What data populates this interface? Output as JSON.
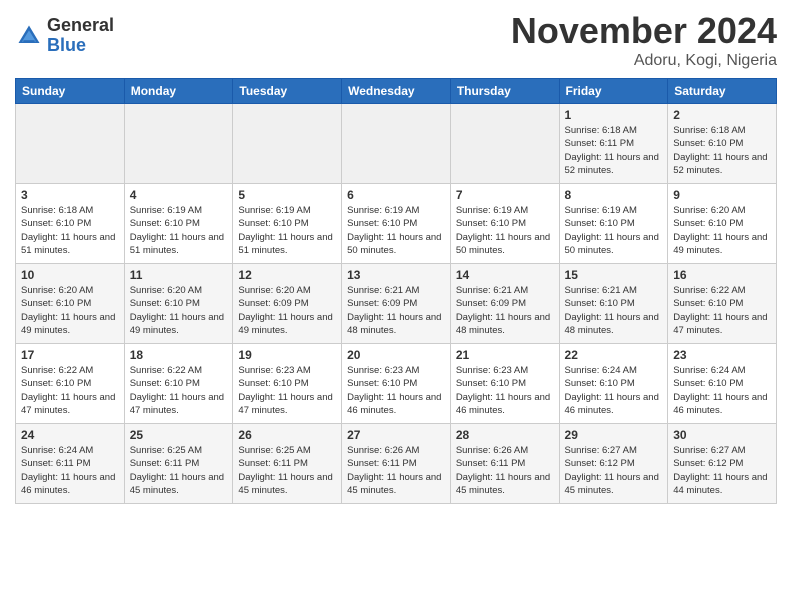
{
  "logo": {
    "general": "General",
    "blue": "Blue"
  },
  "title": "November 2024",
  "location": "Adoru, Kogi, Nigeria",
  "days_of_week": [
    "Sunday",
    "Monday",
    "Tuesday",
    "Wednesday",
    "Thursday",
    "Friday",
    "Saturday"
  ],
  "weeks": [
    [
      {
        "day": "",
        "info": ""
      },
      {
        "day": "",
        "info": ""
      },
      {
        "day": "",
        "info": ""
      },
      {
        "day": "",
        "info": ""
      },
      {
        "day": "",
        "info": ""
      },
      {
        "day": "1",
        "sunrise": "6:18 AM",
        "sunset": "6:11 PM",
        "daylight": "11 hours and 52 minutes."
      },
      {
        "day": "2",
        "sunrise": "6:18 AM",
        "sunset": "6:10 PM",
        "daylight": "11 hours and 52 minutes."
      }
    ],
    [
      {
        "day": "3",
        "sunrise": "6:18 AM",
        "sunset": "6:10 PM",
        "daylight": "11 hours and 51 minutes."
      },
      {
        "day": "4",
        "sunrise": "6:19 AM",
        "sunset": "6:10 PM",
        "daylight": "11 hours and 51 minutes."
      },
      {
        "day": "5",
        "sunrise": "6:19 AM",
        "sunset": "6:10 PM",
        "daylight": "11 hours and 51 minutes."
      },
      {
        "day": "6",
        "sunrise": "6:19 AM",
        "sunset": "6:10 PM",
        "daylight": "11 hours and 50 minutes."
      },
      {
        "day": "7",
        "sunrise": "6:19 AM",
        "sunset": "6:10 PM",
        "daylight": "11 hours and 50 minutes."
      },
      {
        "day": "8",
        "sunrise": "6:19 AM",
        "sunset": "6:10 PM",
        "daylight": "11 hours and 50 minutes."
      },
      {
        "day": "9",
        "sunrise": "6:20 AM",
        "sunset": "6:10 PM",
        "daylight": "11 hours and 49 minutes."
      }
    ],
    [
      {
        "day": "10",
        "sunrise": "6:20 AM",
        "sunset": "6:10 PM",
        "daylight": "11 hours and 49 minutes."
      },
      {
        "day": "11",
        "sunrise": "6:20 AM",
        "sunset": "6:10 PM",
        "daylight": "11 hours and 49 minutes."
      },
      {
        "day": "12",
        "sunrise": "6:20 AM",
        "sunset": "6:09 PM",
        "daylight": "11 hours and 49 minutes."
      },
      {
        "day": "13",
        "sunrise": "6:21 AM",
        "sunset": "6:09 PM",
        "daylight": "11 hours and 48 minutes."
      },
      {
        "day": "14",
        "sunrise": "6:21 AM",
        "sunset": "6:09 PM",
        "daylight": "11 hours and 48 minutes."
      },
      {
        "day": "15",
        "sunrise": "6:21 AM",
        "sunset": "6:10 PM",
        "daylight": "11 hours and 48 minutes."
      },
      {
        "day": "16",
        "sunrise": "6:22 AM",
        "sunset": "6:10 PM",
        "daylight": "11 hours and 47 minutes."
      }
    ],
    [
      {
        "day": "17",
        "sunrise": "6:22 AM",
        "sunset": "6:10 PM",
        "daylight": "11 hours and 47 minutes."
      },
      {
        "day": "18",
        "sunrise": "6:22 AM",
        "sunset": "6:10 PM",
        "daylight": "11 hours and 47 minutes."
      },
      {
        "day": "19",
        "sunrise": "6:23 AM",
        "sunset": "6:10 PM",
        "daylight": "11 hours and 47 minutes."
      },
      {
        "day": "20",
        "sunrise": "6:23 AM",
        "sunset": "6:10 PM",
        "daylight": "11 hours and 46 minutes."
      },
      {
        "day": "21",
        "sunrise": "6:23 AM",
        "sunset": "6:10 PM",
        "daylight": "11 hours and 46 minutes."
      },
      {
        "day": "22",
        "sunrise": "6:24 AM",
        "sunset": "6:10 PM",
        "daylight": "11 hours and 46 minutes."
      },
      {
        "day": "23",
        "sunrise": "6:24 AM",
        "sunset": "6:10 PM",
        "daylight": "11 hours and 46 minutes."
      }
    ],
    [
      {
        "day": "24",
        "sunrise": "6:24 AM",
        "sunset": "6:11 PM",
        "daylight": "11 hours and 46 minutes."
      },
      {
        "day": "25",
        "sunrise": "6:25 AM",
        "sunset": "6:11 PM",
        "daylight": "11 hours and 45 minutes."
      },
      {
        "day": "26",
        "sunrise": "6:25 AM",
        "sunset": "6:11 PM",
        "daylight": "11 hours and 45 minutes."
      },
      {
        "day": "27",
        "sunrise": "6:26 AM",
        "sunset": "6:11 PM",
        "daylight": "11 hours and 45 minutes."
      },
      {
        "day": "28",
        "sunrise": "6:26 AM",
        "sunset": "6:11 PM",
        "daylight": "11 hours and 45 minutes."
      },
      {
        "day": "29",
        "sunrise": "6:27 AM",
        "sunset": "6:12 PM",
        "daylight": "11 hours and 45 minutes."
      },
      {
        "day": "30",
        "sunrise": "6:27 AM",
        "sunset": "6:12 PM",
        "daylight": "11 hours and 44 minutes."
      }
    ]
  ]
}
